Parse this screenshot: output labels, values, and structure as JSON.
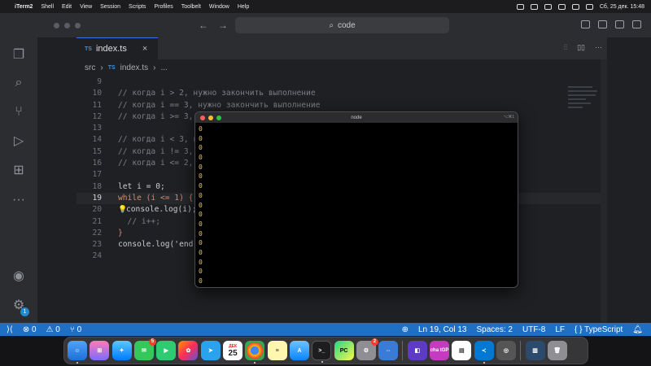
{
  "menubar": {
    "app_name": "iTerm2",
    "items": [
      "Shell",
      "Edit",
      "View",
      "Session",
      "Scripts",
      "Profiles",
      "Toolbelt",
      "Window",
      "Help"
    ],
    "clock": "Сб, 25 дек.  15:48"
  },
  "titlebar": {
    "search_text": "code"
  },
  "activity_bar": {
    "accounts_badge": "1"
  },
  "tabs": [
    {
      "lang": "TS",
      "label": "index.ts",
      "close": "×"
    }
  ],
  "tab_actions": [
    "⫶⫶",
    "▯▯",
    "···"
  ],
  "breadcrumb": {
    "folder": "src",
    "sep1": "›",
    "lang": "TS",
    "file": "index.ts",
    "sep2": "›",
    "more": "..."
  },
  "code_lines": [
    {
      "num": "9",
      "text": ""
    },
    {
      "num": "10",
      "text": "// когда i > 2, нужно закончить выполнение"
    },
    {
      "num": "11",
      "text": "// когда i == 3, нужно закончить выполнение"
    },
    {
      "num": "12",
      "text": "// когда i >= 3, н"
    },
    {
      "num": "13",
      "text": ""
    },
    {
      "num": "14",
      "text": "// когда i < 3, н"
    },
    {
      "num": "15",
      "text": "// когда i != 3,"
    },
    {
      "num": "16",
      "text": "// когда i <= 2,"
    },
    {
      "num": "17",
      "text": ""
    },
    {
      "num": "18",
      "text": "let i = 0;"
    },
    {
      "num": "19",
      "text": "while (i <= 1) {"
    },
    {
      "num": "20",
      "text": "console.log(i);"
    },
    {
      "num": "21",
      "text": "  // i++;"
    },
    {
      "num": "22",
      "text": "}"
    },
    {
      "num": "23",
      "text": "console.log('end'"
    },
    {
      "num": "24",
      "text": ""
    }
  ],
  "terminal": {
    "title": "node",
    "shortcut": "⌥⌘1",
    "output": [
      "0",
      "0",
      "0",
      "0",
      "0",
      "0",
      "0",
      "0",
      "0",
      "0",
      "0",
      "0",
      "0",
      "0",
      "0",
      "0",
      "0",
      "0"
    ]
  },
  "statusbar": {
    "errors": "⊗ 0",
    "warnings": "⚠ 0",
    "ports": "⑂ 0",
    "position": "Ln 19, Col 13",
    "spaces": "Spaces: 2",
    "encoding": "UTF-8",
    "eol": "LF",
    "language": "{ }  TypeScript"
  },
  "dock": {
    "calendar_day": "25",
    "calendar_month": "ДЕК",
    "facetime_badge": "5",
    "pycharm_label": "PC",
    "chatgpt_label": "cha tGP",
    "settings_badge": "2"
  },
  "colors": {
    "accent": "#3574f0",
    "statusbar": "#1f6fc5",
    "terminal_text": "#e8c15b"
  }
}
